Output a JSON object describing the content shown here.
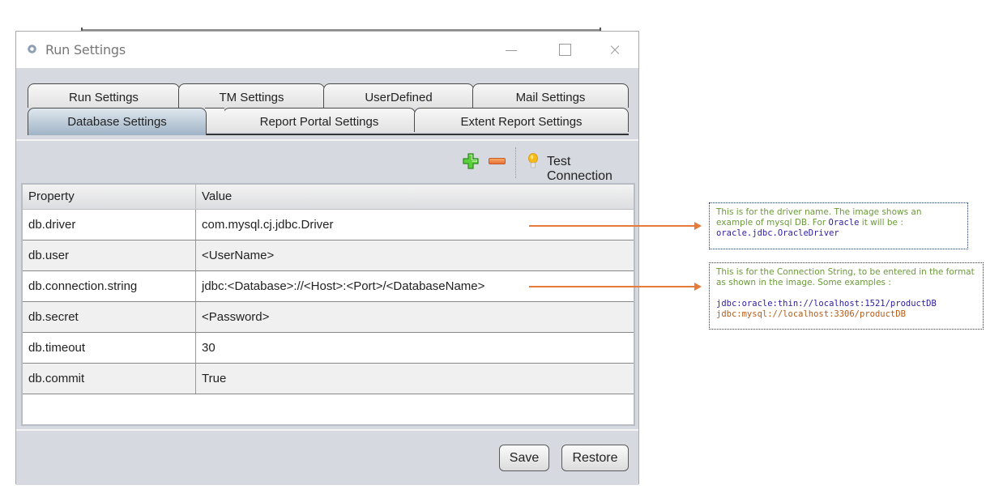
{
  "window": {
    "title": "Run Settings",
    "controls": {
      "minimize": "minimize",
      "maximize": "maximize",
      "close": "×"
    }
  },
  "tabs": {
    "row1": [
      "Run Settings",
      "TM Settings",
      "UserDefined",
      "Mail Settings"
    ],
    "row2": [
      "Database Settings",
      "Report Portal Settings",
      "Extent Report Settings"
    ],
    "active": "Database Settings"
  },
  "toolbar": {
    "add_icon": "plus-icon",
    "remove_icon": "minus-icon",
    "test_connection_label": "Test Connection"
  },
  "table": {
    "columns": [
      "Property",
      "Value"
    ],
    "rows": [
      {
        "property": "db.driver",
        "value": "com.mysql.cj.jdbc.Driver"
      },
      {
        "property": "db.user",
        "value": "<UserName>"
      },
      {
        "property": "db.connection.string",
        "value": "jdbc:<Database>://<Host>:<Port>/<DatabaseName>"
      },
      {
        "property": "db.secret",
        "value": "<Password>"
      },
      {
        "property": "db.timeout",
        "value": "30"
      },
      {
        "property": "db.commit",
        "value": "True"
      }
    ]
  },
  "footer": {
    "save_label": "Save",
    "restore_label": "Restore"
  },
  "annotations": {
    "driver_note": {
      "text1": "This is for the driver name. The image shows an example of mysql DB. For ",
      "keyword": "Oracle",
      "text2": " it will be :",
      "code": "oracle.jdbc.OracleDriver"
    },
    "connection_note": {
      "text": "This is for the Connection String, to be entered in the format as shown in the image. Some examples :",
      "example_oracle": "jdbc:oracle:thin://localhost:1521/productDB",
      "example_mysql": "jdbc:mysql://localhost:3306/productDB"
    }
  },
  "colors": {
    "arrow": "#e57a3a",
    "note_text": "#6a9a38",
    "code_blue": "#2d1ca0",
    "code_orange": "#b65b18",
    "active_tab": "#9fb3c6"
  }
}
